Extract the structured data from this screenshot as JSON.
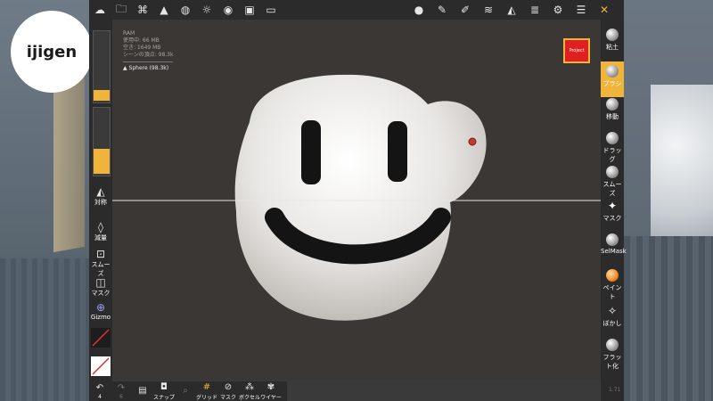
{
  "logo": {
    "text": "ijigen"
  },
  "info": {
    "ram_label": "RAM",
    "used": "使用中: 66 MB",
    "free": "空き: 1649 MB",
    "vertices": "シーンの頂点: 98.3k",
    "object_name": "Sphere (98.3k)"
  },
  "project_button": "Project",
  "left_tools": {
    "symmetry": "対称",
    "decimate": "減量",
    "smooth": "スムーズ",
    "mask": "マスク",
    "gizmo": "Gizmo"
  },
  "right_tools": [
    {
      "label": "粘土"
    },
    {
      "label": "ブラシ",
      "selected": true
    },
    {
      "label": "移動"
    },
    {
      "label": "ドラッグ"
    },
    {
      "label": "スムーズ"
    },
    {
      "label": "マスク"
    },
    {
      "label": "SelMask"
    },
    {
      "label": "ペイント"
    },
    {
      "label": "ぼかし"
    },
    {
      "label": "フラット化"
    }
  ],
  "bottom_tools": {
    "undo_count": "4",
    "redo_count": "6",
    "snap": "スナップ",
    "grid": "グリッド",
    "mask": "マスク",
    "voxel": "ボクセル",
    "wire": "ワイヤー"
  },
  "version": "1.71",
  "colors": {
    "accent": "#f0b43a",
    "project": "#e02020"
  }
}
